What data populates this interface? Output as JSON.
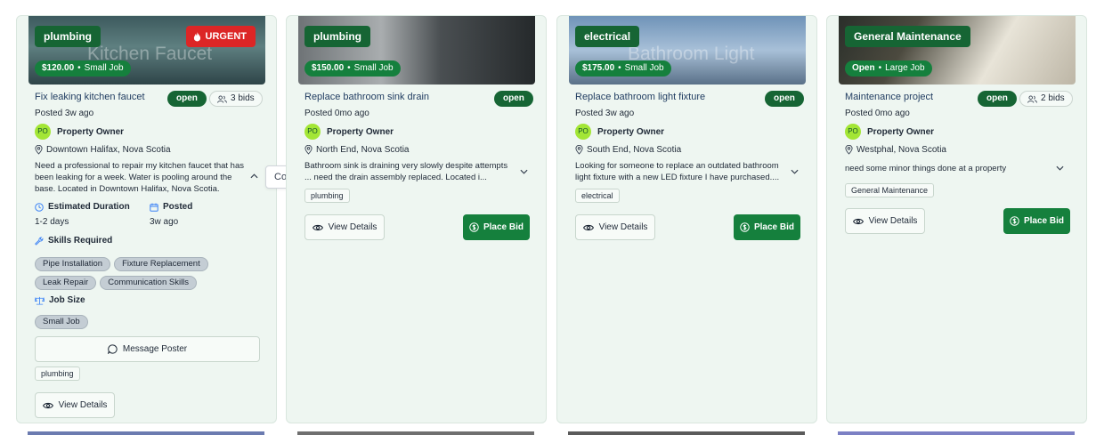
{
  "cards": [
    {
      "category": "plumbing",
      "urgent_label": "URGENT",
      "watermark": "Kitchen Faucet",
      "price": "$120.00",
      "job_size": "Small Job",
      "title": "Fix leaking kitchen faucet",
      "status": "open",
      "bids": "3 bids",
      "posted": "Posted 3w ago",
      "avatar": "PO",
      "owner": "Property Owner",
      "location": "Downtown Halifax, Nova Scotia",
      "description": "Need a professional to repair my kitchen faucet that has been leaking for a week. Water is pooling around the base. Located in Downtown Halifax, Nova Scotia.",
      "duration_label": "Estimated Duration",
      "duration_value": "1-2 days",
      "posted_label": "Posted",
      "posted_value": "3w ago",
      "skills_label": "Skills Required",
      "skills": [
        "Pipe Installation",
        "Fixture Replacement",
        "Leak Repair",
        "Communication Skills"
      ],
      "job_size_label": "Job Size",
      "job_size_value": "Small Job",
      "message_button": "Message Poster",
      "tag": "plumbing",
      "view_button": "View Details"
    },
    {
      "category": "plumbing",
      "price": "$150.00",
      "job_size": "Small Job",
      "title": "Replace bathroom sink drain",
      "status": "open",
      "posted": "Posted 0mo ago",
      "avatar": "PO",
      "owner": "Property Owner",
      "location": "North End, Nova Scotia",
      "description": "Bathroom sink is draining very slowly despite attempts ... need the drain assembly replaced. Located i...",
      "tag": "plumbing",
      "view_button": "View Details",
      "bid_button": "Place Bid"
    },
    {
      "category": "electrical",
      "watermark": "Bathroom Light",
      "price": "$175.00",
      "job_size": "Small Job",
      "title": "Replace bathroom light fixture",
      "status": "open",
      "posted": "Posted 3w ago",
      "avatar": "PO",
      "owner": "Property Owner",
      "location": "South End, Nova Scotia",
      "description": "Looking for someone to replace an outdated bathroom light fixture with a new LED fixture I have purchased....",
      "tag": "electrical",
      "view_button": "View Details",
      "bid_button": "Place Bid"
    },
    {
      "category": "General Maintenance",
      "price": "Open",
      "job_size": "Large Job",
      "title": "Maintenance project",
      "status": "open",
      "bids": "2 bids",
      "posted": "Posted 0mo ago",
      "avatar": "PO",
      "owner": "Property Owner",
      "location": "Westphal, Nova Scotia",
      "description": "need some minor things done at a property",
      "tag": "General Maintenance",
      "view_button": "View Details",
      "bid_button": "Place Bid"
    }
  ],
  "tooltip": "Collapse details",
  "colors": {
    "primary": "#15803d",
    "urgent": "#dc2626",
    "card_bg": "#eef6f1"
  }
}
